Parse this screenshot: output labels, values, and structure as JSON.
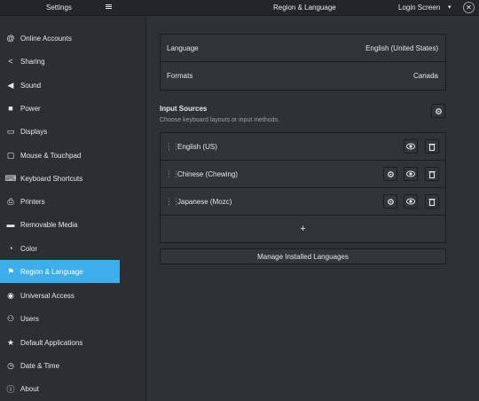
{
  "header": {
    "title": "Settings",
    "center_title": "Region & Language",
    "login_label": "Login Screen",
    "arrow": "▾",
    "close": "✕"
  },
  "sidebar": {
    "items": [
      {
        "label": "Online Accounts",
        "icon": "at-icon",
        "glyph": "@"
      },
      {
        "label": "Sharing",
        "icon": "share-icon",
        "glyph": "<"
      },
      {
        "label": "Sound",
        "icon": "speaker-icon",
        "glyph": "◀"
      },
      {
        "label": "Power",
        "icon": "power-icon",
        "glyph": "■"
      },
      {
        "label": "Displays",
        "icon": "display-icon",
        "glyph": "▭"
      },
      {
        "label": "Mouse & Touchpad",
        "icon": "mouse-icon",
        "glyph": "▢"
      },
      {
        "label": "Keyboard Shortcuts",
        "icon": "keyboard-icon",
        "glyph": "⌨"
      },
      {
        "label": "Printers",
        "icon": "printer-icon",
        "glyph": "⎙"
      },
      {
        "label": "Removable Media",
        "icon": "media-icon",
        "glyph": "▬"
      },
      {
        "label": "Color",
        "icon": "color-icon",
        "glyph": "◔"
      },
      {
        "label": "Region & Language",
        "icon": "flag-icon",
        "glyph": "⚑",
        "active": true
      },
      {
        "label": "Universal Access",
        "icon": "accessibility-icon",
        "glyph": "◉"
      },
      {
        "label": "Users",
        "icon": "users-icon",
        "glyph": "⚇"
      },
      {
        "label": "Default Applications",
        "icon": "star-icon",
        "glyph": "★"
      },
      {
        "label": "Date & Time",
        "icon": "clock-icon",
        "glyph": "◷"
      },
      {
        "label": "About",
        "icon": "info-icon",
        "glyph": "ⓘ"
      }
    ]
  },
  "language": {
    "language_label": "Language",
    "language_value": "English (United States)",
    "formats_label": "Formats",
    "formats_value": "Canada"
  },
  "input_sources": {
    "title": "Input Sources",
    "subtitle": "Choose keyboard layouts or input methods.",
    "sources": [
      {
        "name": "English (US)",
        "has_settings": false
      },
      {
        "name": "Chinese (Chewing)",
        "has_settings": true
      },
      {
        "name": "Japanese (Mozc)",
        "has_settings": true
      }
    ],
    "add_label": "+"
  },
  "manage_label": "Manage Installed Languages",
  "colors": {
    "accent": "#3daee9",
    "background": "#2d3237"
  }
}
